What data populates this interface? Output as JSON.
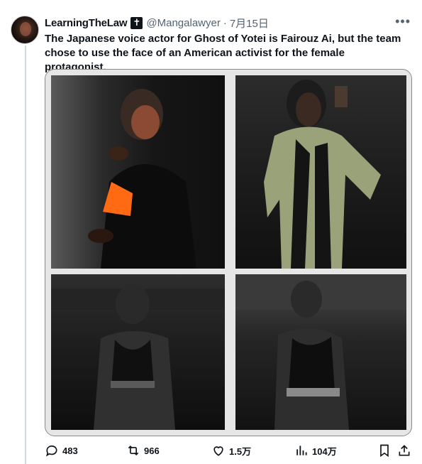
{
  "tweet": {
    "author_name": "LearningTheLaw",
    "badge_glyph": "✝",
    "handle": "@Mangalawyer",
    "separator": "·",
    "date": "7月15日",
    "more_glyph": "•••",
    "text": "The Japanese voice actor for Ghost of Yotei is Fairouz Ai, but the team chose to use the face of an American activist for the female protagonist."
  },
  "media": {
    "photos": [
      {
        "icon": "photo-woman-with-orange-paper"
      },
      {
        "icon": "photo-woman-in-blouse-mirror-selfie"
      },
      {
        "icon": "photo-woman-in-tank-top-front"
      },
      {
        "icon": "photo-woman-in-tank-top-side"
      }
    ]
  },
  "actions": {
    "reply": {
      "icon": "reply-icon",
      "count": "483"
    },
    "repost": {
      "icon": "repost-icon",
      "count": "966"
    },
    "like": {
      "icon": "heart-icon",
      "count": "1.5万"
    },
    "views": {
      "icon": "views-chart-icon",
      "count": "104万"
    },
    "bookmark": {
      "icon": "bookmark-icon"
    },
    "share": {
      "icon": "share-icon"
    }
  },
  "colors": {
    "text": "#0f1419",
    "muted": "#536471",
    "thread_line": "#cfd9de",
    "photo_accent_orange": "#ff6a13"
  }
}
